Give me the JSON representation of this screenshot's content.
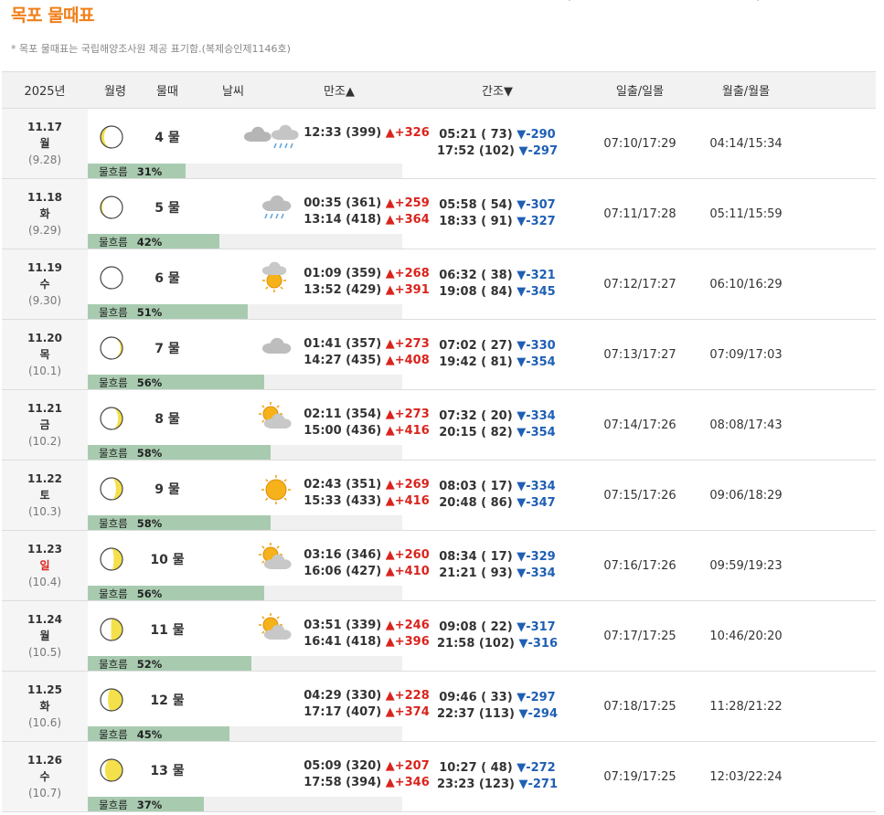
{
  "page": {
    "title": "목포 물때표",
    "notice": "* 목포 물때표는 국립해양조사원 제공 표기함.(복제승인제1146호)"
  },
  "colors": {
    "title": "#f07f1a",
    "high": "#d9241d",
    "low": "#1f5fb4",
    "flow_bar": "#a8cbb0"
  },
  "header": {
    "year": "2025년",
    "moon": "월령",
    "mulddae": "물때",
    "weather": "날씨",
    "high": "만조▲",
    "low": "간조▼",
    "sun": "일출/일몰",
    "moonrise": "월출/월몰"
  },
  "flow_label": "물흐름",
  "rows": [
    {
      "date": "11.17",
      "dow": "월",
      "lunar": "(9.28)",
      "sunday": false,
      "moon_phase": 0.92,
      "mulddae": "4 물",
      "weather": "cloud-rain-icon",
      "high": [
        {
          "time": "12:33 (399)",
          "diff": "▲+326"
        }
      ],
      "low": [
        {
          "time": "05:21 ( 73)",
          "diff": "▼-290"
        },
        {
          "time": "17:52 (102)",
          "diff": "▼-297"
        }
      ],
      "sun": "07:10/17:29",
      "moon": "04:14/15:34",
      "flow": "31%",
      "flow_value": 0.31
    },
    {
      "date": "11.18",
      "dow": "화",
      "lunar": "(9.29)",
      "sunday": false,
      "moon_phase": 0.96,
      "mulddae": "5 물",
      "weather": "rain-icon",
      "high": [
        {
          "time": "00:35 (361)",
          "diff": "▲+259"
        },
        {
          "time": "13:14 (418)",
          "diff": "▲+364"
        }
      ],
      "low": [
        {
          "time": "05:58 ( 54)",
          "diff": "▼-307"
        },
        {
          "time": "18:33 ( 91)",
          "diff": "▼-327"
        }
      ],
      "sun": "07:11/17:28",
      "moon": "05:11/15:59",
      "flow": "42%",
      "flow_value": 0.42
    },
    {
      "date": "11.19",
      "dow": "수",
      "lunar": "(9.30)",
      "sunday": false,
      "moon_phase": 0.0,
      "mulddae": "6 물",
      "weather": "sun-cloud-icon",
      "high": [
        {
          "time": "01:09 (359)",
          "diff": "▲+268"
        },
        {
          "time": "13:52 (429)",
          "diff": "▲+391"
        }
      ],
      "low": [
        {
          "time": "06:32 ( 38)",
          "diff": "▼-321"
        },
        {
          "time": "19:08 ( 84)",
          "diff": "▼-345"
        }
      ],
      "sun": "07:12/17:27",
      "moon": "06:10/16:29",
      "flow": "51%",
      "flow_value": 0.51
    },
    {
      "date": "11.20",
      "dow": "목",
      "lunar": "(10.1)",
      "sunday": false,
      "moon_phase": 0.05,
      "mulddae": "7 물",
      "weather": "cloud-icon",
      "high": [
        {
          "time": "01:41 (357)",
          "diff": "▲+273"
        },
        {
          "time": "14:27 (435)",
          "diff": "▲+408"
        }
      ],
      "low": [
        {
          "time": "07:02 ( 27)",
          "diff": "▼-330"
        },
        {
          "time": "19:42 ( 81)",
          "diff": "▼-354"
        }
      ],
      "sun": "07:13/17:27",
      "moon": "07:09/17:03",
      "flow": "56%",
      "flow_value": 0.56
    },
    {
      "date": "11.21",
      "dow": "금",
      "lunar": "(10.2)",
      "sunday": false,
      "moon_phase": 0.1,
      "mulddae": "8 물",
      "weather": "sun-behind-cloud-icon",
      "high": [
        {
          "time": "02:11 (354)",
          "diff": "▲+273"
        },
        {
          "time": "15:00 (436)",
          "diff": "▲+416"
        }
      ],
      "low": [
        {
          "time": "07:32 ( 20)",
          "diff": "▼-334"
        },
        {
          "time": "20:15 ( 82)",
          "diff": "▼-354"
        }
      ],
      "sun": "07:14/17:26",
      "moon": "08:08/17:43",
      "flow": "58%",
      "flow_value": 0.58
    },
    {
      "date": "11.22",
      "dow": "토",
      "lunar": "(10.3)",
      "sunday": false,
      "moon_phase": 0.15,
      "mulddae": "9 물",
      "weather": "sun-icon",
      "high": [
        {
          "time": "02:43 (351)",
          "diff": "▲+269"
        },
        {
          "time": "15:33 (433)",
          "diff": "▲+416"
        }
      ],
      "low": [
        {
          "time": "08:03 ( 17)",
          "diff": "▼-334"
        },
        {
          "time": "20:48 ( 86)",
          "diff": "▼-347"
        }
      ],
      "sun": "07:15/17:26",
      "moon": "09:06/18:29",
      "flow": "58%",
      "flow_value": 0.58
    },
    {
      "date": "11.23",
      "dow": "일",
      "lunar": "(10.4)",
      "sunday": true,
      "moon_phase": 0.2,
      "mulddae": "10 물",
      "weather": "sun-behind-cloud-icon",
      "high": [
        {
          "time": "03:16 (346)",
          "diff": "▲+260"
        },
        {
          "time": "16:06 (427)",
          "diff": "▲+410"
        }
      ],
      "low": [
        {
          "time": "08:34 ( 17)",
          "diff": "▼-329"
        },
        {
          "time": "21:21 ( 93)",
          "diff": "▼-334"
        }
      ],
      "sun": "07:16/17:26",
      "moon": "09:59/19:23",
      "flow": "56%",
      "flow_value": 0.56
    },
    {
      "date": "11.24",
      "dow": "월",
      "lunar": "(10.5)",
      "sunday": false,
      "moon_phase": 0.26,
      "mulddae": "11 물",
      "weather": "sun-behind-cloud-icon",
      "high": [
        {
          "time": "03:51 (339)",
          "diff": "▲+246"
        },
        {
          "time": "16:41 (418)",
          "diff": "▲+396"
        }
      ],
      "low": [
        {
          "time": "09:08 ( 22)",
          "diff": "▼-317"
        },
        {
          "time": "21:58 (102)",
          "diff": "▼-316"
        }
      ],
      "sun": "07:17/17:25",
      "moon": "10:46/20:20",
      "flow": "52%",
      "flow_value": 0.52
    },
    {
      "date": "11.25",
      "dow": "화",
      "lunar": "(10.6)",
      "sunday": false,
      "moon_phase": 0.33,
      "mulddae": "12 물",
      "weather": "none",
      "high": [
        {
          "time": "04:29 (330)",
          "diff": "▲+228"
        },
        {
          "time": "17:17 (407)",
          "diff": "▲+374"
        }
      ],
      "low": [
        {
          "time": "09:46 ( 33)",
          "diff": "▼-297"
        },
        {
          "time": "22:37 (113)",
          "diff": "▼-294"
        }
      ],
      "sun": "07:18/17:25",
      "moon": "11:28/21:22",
      "flow": "45%",
      "flow_value": 0.45
    },
    {
      "date": "11.26",
      "dow": "수",
      "lunar": "(10.7)",
      "sunday": false,
      "moon_phase": 0.4,
      "mulddae": "13 물",
      "weather": "none",
      "high": [
        {
          "time": "05:09 (320)",
          "diff": "▲+207"
        },
        {
          "time": "17:58 (394)",
          "diff": "▲+346"
        }
      ],
      "low": [
        {
          "time": "10:27 ( 48)",
          "diff": "▼-272"
        },
        {
          "time": "23:23 (123)",
          "diff": "▼-271"
        }
      ],
      "sun": "07:19/17:25",
      "moon": "12:03/22:24",
      "flow": "37%",
      "flow_value": 0.37
    }
  ]
}
